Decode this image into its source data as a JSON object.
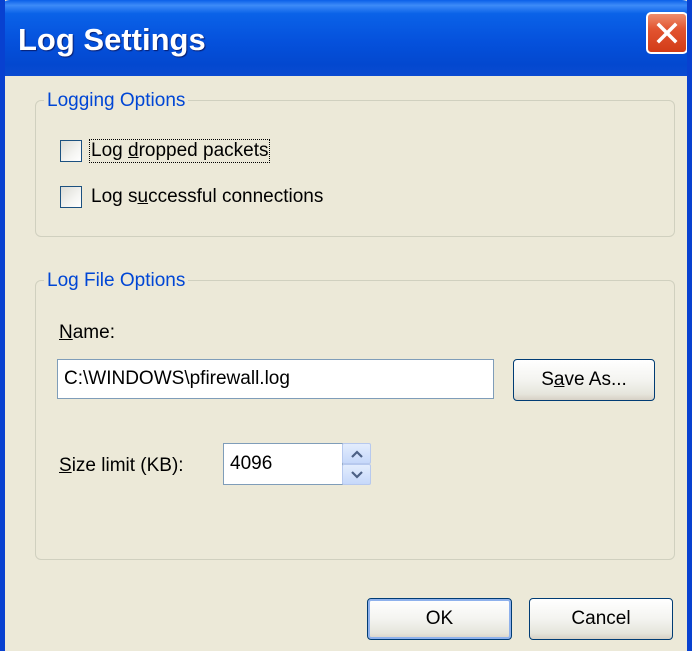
{
  "window": {
    "title": "Log Settings"
  },
  "logging_options": {
    "legend": "Logging Options",
    "log_dropped_packets": {
      "label_pre": "Log ",
      "label_ul": "d",
      "label_post": "ropped packets",
      "checked": false
    },
    "log_successful_connections": {
      "label_pre": "Log s",
      "label_ul": "u",
      "label_post": "ccessful connections",
      "checked": false
    }
  },
  "log_file_options": {
    "legend": "Log File Options",
    "name_label_ul": "N",
    "name_label_post": "ame:",
    "name_value": "C:\\WINDOWS\\pfirewall.log",
    "save_as_pre": "S",
    "save_as_ul": "a",
    "save_as_post": "ve As...",
    "size_label_ul": "S",
    "size_label_post": "ize limit (KB):",
    "size_value": "4096"
  },
  "buttons": {
    "ok_label": "OK",
    "cancel_label": "Cancel"
  },
  "colors": {
    "title_bar": "#0551dc",
    "close_button": "#e25430",
    "group_legend": "#0046d5",
    "dialog_background": "#ece9d8"
  },
  "icons": {
    "close": "close-icon",
    "spin_up": "chevron-up-icon",
    "spin_down": "chevron-down-icon"
  }
}
